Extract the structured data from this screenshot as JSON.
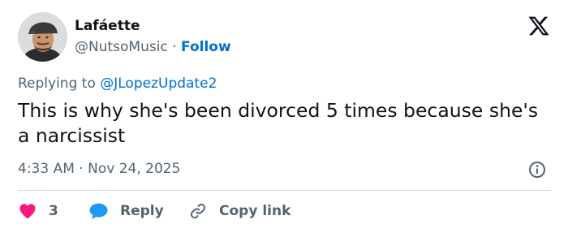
{
  "author": {
    "display_name": "Lafáette",
    "handle": "@NutsoMusic",
    "separator": "·",
    "follow_label": "Follow"
  },
  "reply_context": {
    "prefix": "Replying to ",
    "mention": "@JLopezUpdate2"
  },
  "tweet": {
    "text": "This is why she's been divorced 5 times because she's a narcissist",
    "time": "4:33 AM",
    "separator": "·",
    "date": "Nov 24, 2025"
  },
  "actions": {
    "like_count": "3",
    "reply_label": "Reply",
    "copy_link_label": "Copy link"
  },
  "colors": {
    "text": "#0f1419",
    "muted": "#536471",
    "link": "#006fd6",
    "like": "#f91880",
    "reply": "#1d9bf0",
    "divider": "#cfd9de"
  },
  "icons": [
    "x-logo-icon",
    "info-icon",
    "heart-icon",
    "reply-bubble-icon",
    "link-icon"
  ]
}
